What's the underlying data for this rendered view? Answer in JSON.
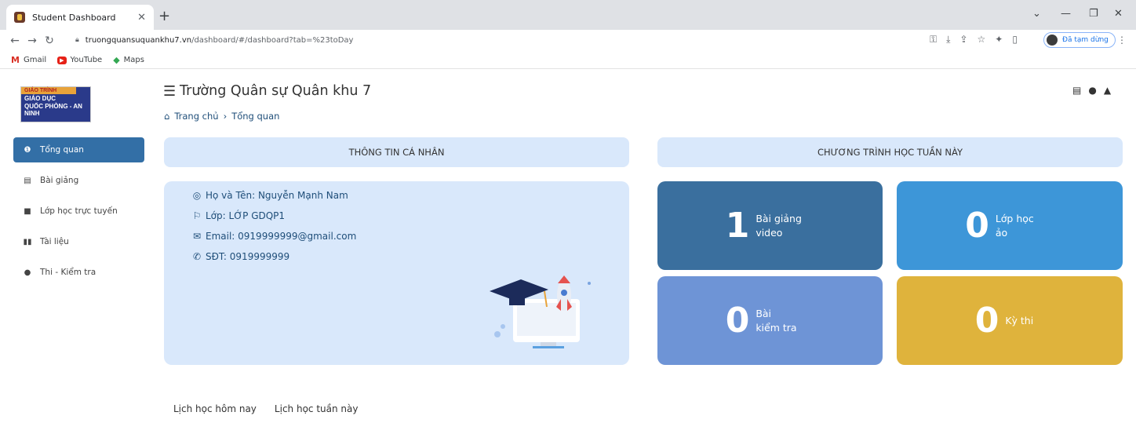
{
  "browser": {
    "tab_title": "Student Dashboard",
    "tab_close": "✕",
    "new_tab": "+",
    "url_host": "truongquansuquankhu7.vn",
    "url_path": "/dashboard/#/dashboard?tab=%23toDay",
    "profile_status": "Đã tạm dừng",
    "bookmarks": [
      "Gmail",
      "YouTube",
      "Maps"
    ]
  },
  "sidebar": {
    "logo_line1": "GIÁO TRÌNH",
    "logo_line2": "GIÁO DỤC",
    "logo_line3": "QUỐC PHÒNG - AN NINH",
    "items": [
      {
        "label": "Tổng quan",
        "icon": "info-circle-icon"
      },
      {
        "label": "Bài giảng",
        "icon": "list-icon"
      },
      {
        "label": "Lớp học trực tuyến",
        "icon": "video-icon"
      },
      {
        "label": "Tài liệu",
        "icon": "book-icon"
      },
      {
        "label": "Thi - Kiểm tra",
        "icon": "clock-icon"
      }
    ]
  },
  "header": {
    "title": "Trường Quân sự Quân khu 7",
    "breadcrumb_home": "Trang chủ",
    "breadcrumb_current": "Tổng quan"
  },
  "personal": {
    "section_title": "THÔNG TIN CÁ NHÂN",
    "name": "Họ và Tên: Nguyễn Mạnh Nam",
    "class": "Lớp: LỚP GDQP1",
    "email": "Email: 0919999999@gmail.com",
    "phone": "SĐT: 0919999999"
  },
  "weekly": {
    "section_title": "CHƯƠNG TRÌNH HỌC TUẦN NÀY",
    "stats": [
      {
        "num": "1",
        "label1": "Bài giảng",
        "label2": "video",
        "color": "#3a6f9e"
      },
      {
        "num": "0",
        "label1": "Lớp học",
        "label2": "ảo",
        "color": "#3d96d8"
      },
      {
        "num": "0",
        "label1": "Bài",
        "label2": "kiểm tra",
        "color": "#6e94d6"
      },
      {
        "num": "0",
        "label1": "Kỳ thi",
        "label2": "",
        "color": "#dfb33c"
      }
    ]
  },
  "schedule_tabs": [
    "Lịch học hôm nay",
    "Lịch học tuần này"
  ]
}
